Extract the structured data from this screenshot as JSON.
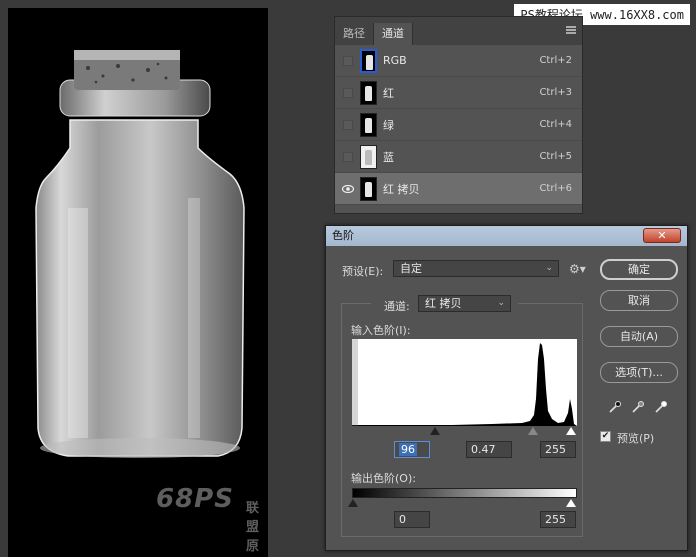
{
  "watermark": "PS教程论坛 www.16XX8.com",
  "canvas": {
    "logo_text": "68PS",
    "logo_subtext": "联盟原创"
  },
  "channels_panel": {
    "tabs": [
      {
        "label": "路径"
      },
      {
        "label": "通道"
      }
    ],
    "channels": [
      {
        "name": "RGB",
        "shortcut": "Ctrl+2"
      },
      {
        "name": "红",
        "shortcut": "Ctrl+3"
      },
      {
        "name": "绿",
        "shortcut": "Ctrl+4"
      },
      {
        "name": "蓝",
        "shortcut": "Ctrl+5"
      },
      {
        "name": "红 拷贝",
        "shortcut": "Ctrl+6"
      }
    ]
  },
  "levels_dialog": {
    "title": "色阶",
    "close_label": "✕",
    "preset_label": "预设(E):",
    "preset_value": "自定",
    "channel_label": "通道:",
    "channel_value": "红 拷贝",
    "input_levels_label": "输入色阶(I):",
    "input_black": "96",
    "input_gamma": "0.47",
    "input_white": "255",
    "output_levels_label": "输出色阶(O):",
    "output_black": "0",
    "output_white": "255",
    "buttons": {
      "ok": "确定",
      "cancel": "取消",
      "auto": "自动(A)",
      "options": "选项(T)..."
    },
    "preview_label": "预览(P)",
    "preview_checked": true
  }
}
